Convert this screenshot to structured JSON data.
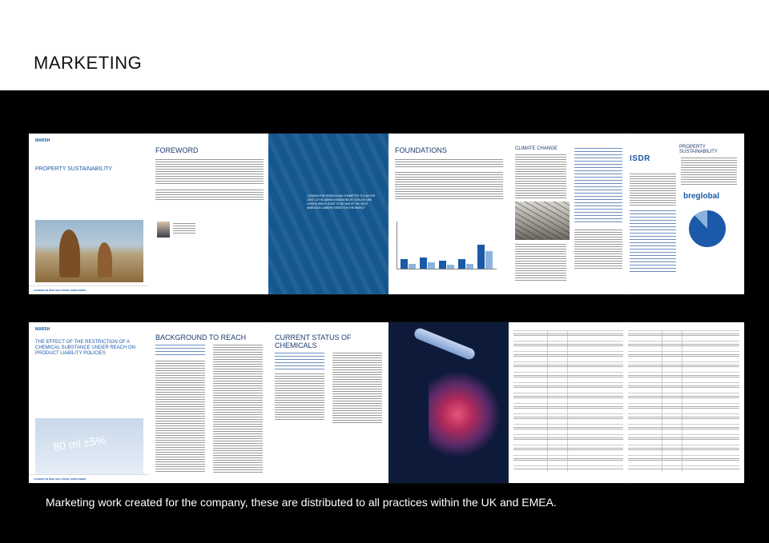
{
  "header": {
    "title": "MARKETING"
  },
  "brand": {
    "name": "MARSH",
    "accent": "#1a5aa8",
    "dark_blue": "#1b3a6b"
  },
  "row1": [
    {
      "id": "cover-property",
      "title": "PROPERTY SUSTAINABILITY",
      "footer": "LEADERS IN RISK SOLUTIONS, WORLDWIDE"
    },
    {
      "id": "foreword",
      "title": "FOREWORD"
    },
    {
      "id": "quote",
      "quote": "“LONDON FOR NORDICA HAS COMMITTED TO A 60 PER CENT CUT IN CARBON EMISSIONS BY 2025 (ON 1990 LEVELS) WHICH IS SET TO BE ONE OF THE MOST AMBITIOUS CARBON TARGETS IN THE WORLD”"
    },
    {
      "id": "foundations",
      "title": "FOUNDATIONS"
    },
    {
      "id": "climate-change",
      "title": "CLIMATE CHANGE"
    },
    {
      "id": "property-sustainability",
      "title": "PROPERTY SUSTAINABILITY",
      "logo1": "ISDR",
      "logo2": "breglobal"
    }
  ],
  "row2": [
    {
      "id": "cover-restriction",
      "title": "THE EFFECT OF THE RESTRICTION OF A CHEMICAL SUBSTANCE UNDER REACH ON PRODUCT LIABILITY POLICIES",
      "bottle": "80 ml ±5%"
    },
    {
      "id": "background",
      "title": "BACKGROUND TO REACH"
    },
    {
      "id": "current-status",
      "title": "CURRENT STATUS OF CHEMICALS"
    },
    {
      "id": "lab-image"
    },
    {
      "id": "table-a"
    },
    {
      "id": "table-b"
    }
  ],
  "caption": "Marketing work created for the company, these are distributed to all practices within the UK and EMEA."
}
